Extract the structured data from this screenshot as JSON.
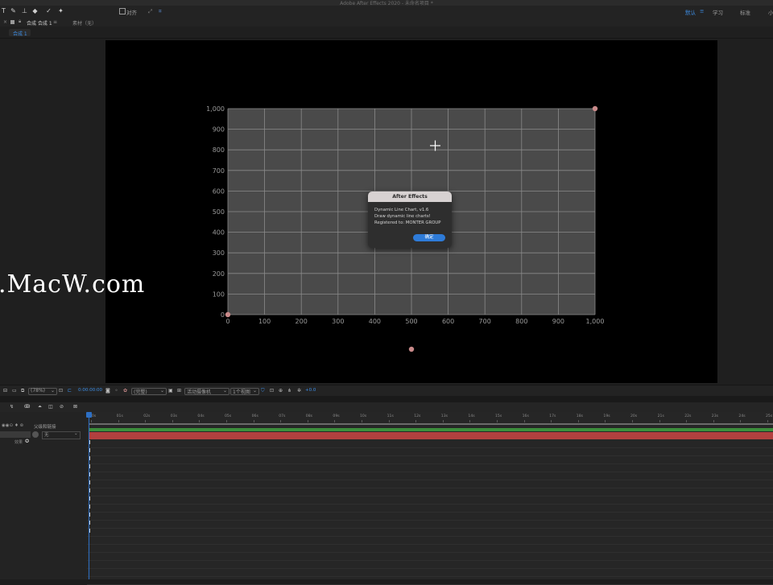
{
  "app": {
    "window_title": "Adobe After Effects 2020 - 未命名项目 *"
  },
  "toolbar": {
    "tools": [
      "T",
      "✎",
      "⊥",
      "◆",
      "✓",
      "✦"
    ],
    "snap_label": "对齐",
    "workspaces": [
      "默认",
      "≡",
      "学习",
      "标准",
      "小"
    ]
  },
  "comp_panel": {
    "tab_label": "合成 合成 1",
    "footage_label": "素材（无）",
    "subtab": "合成 1"
  },
  "watermark": ".MacW.com",
  "chart_data": {
    "type": "line",
    "title": "",
    "xlabel": "",
    "ylabel": "",
    "xlim": [
      0,
      1000
    ],
    "ylim": [
      0,
      1000
    ],
    "x_ticks": [
      "0",
      "100",
      "200",
      "300",
      "400",
      "500",
      "600",
      "700",
      "800",
      "900",
      "1,000"
    ],
    "y_ticks": [
      "0",
      "100",
      "200",
      "300",
      "400",
      "500",
      "600",
      "700",
      "800",
      "900",
      "1,000"
    ],
    "grid": true,
    "points": [
      {
        "x": 0,
        "y": 0
      },
      {
        "x": 1000,
        "y": 1000
      }
    ],
    "colors": {
      "plot_bg": "#4a4a4a",
      "grid": "#8a8a8a",
      "point": "#c98a8a",
      "tick_text": "#9a9a9a"
    }
  },
  "dialog": {
    "title": "After Effects",
    "lines": [
      "Dynamic Line Chart, v1.6",
      "Draw dynamic line charts!",
      "Registered to: MONTER GROUP"
    ],
    "ok_label": "确定"
  },
  "viewer_controls": {
    "zoom": "(78%)",
    "timecode": "0:00:00:00",
    "resolution": "(完整)",
    "camera": "活动摄像机",
    "views": "1个视图",
    "exposure": "+0.0"
  },
  "timeline": {
    "header_label": "父级和链接",
    "parent_value": "无",
    "layer_label": "效果",
    "ruler_labels": [
      "00s",
      "01s",
      "02s",
      "03s",
      "04s",
      "05s",
      "06s",
      "07s",
      "08s",
      "09s",
      "10s",
      "11s",
      "12s",
      "13s",
      "14s",
      "15s",
      "16s",
      "17s",
      "18s",
      "19s",
      "20s",
      "21s",
      "22s",
      "23s",
      "24s",
      "25s"
    ],
    "accent": "#2d6fc4"
  }
}
